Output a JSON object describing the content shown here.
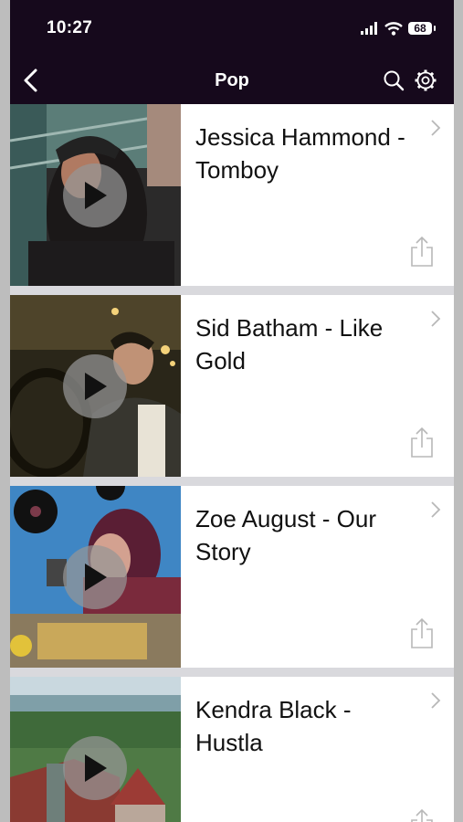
{
  "status_bar": {
    "time": "10:27",
    "battery": "68"
  },
  "nav": {
    "title": "Pop",
    "back_icon": "chevron-left-icon",
    "search_icon": "search-icon",
    "settings_icon": "gear-icon"
  },
  "videos": [
    {
      "title": "Jessica Hammond - Tomboy"
    },
    {
      "title": "Sid Batham - Like Gold"
    },
    {
      "title": "Zoe August - Our Story"
    },
    {
      "title": "Kendra Black - Hustla"
    }
  ],
  "colors": {
    "bar_bg": "#16091c",
    "separator": "#d9d9dd",
    "icon_gray": "#b8b8b8"
  }
}
